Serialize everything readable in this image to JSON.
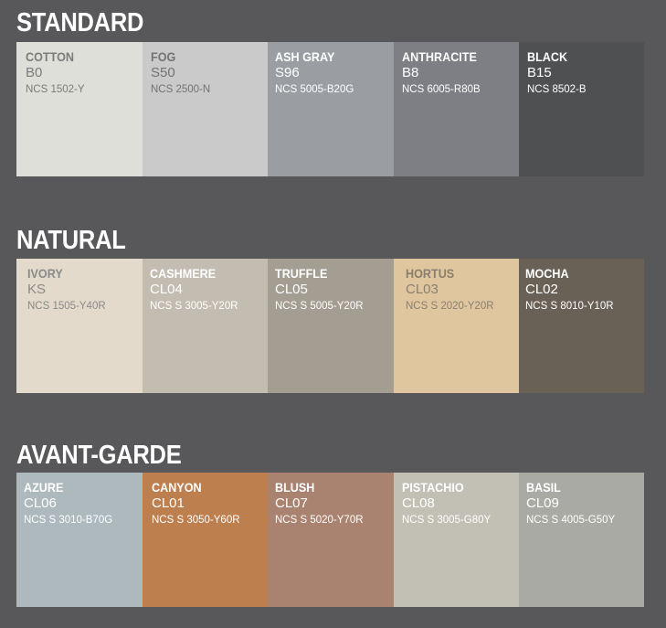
{
  "sections": [
    {
      "title": "STANDARD",
      "swatches": [
        {
          "name": "COTTON",
          "code": "B0",
          "ncs": "NCS 1502-Y",
          "color": "#dfdfd9",
          "name_color": "#7b7b7b",
          "text_color": "#7b7b7b"
        },
        {
          "name": "FOG",
          "code": "S50",
          "ncs": "NCS 2500-N",
          "color": "#cacaca",
          "name_color": "#737373",
          "text_color": "#737373"
        },
        {
          "name": "ASH GRAY",
          "code": "S96",
          "ncs": "NCS 5005-B20G",
          "color": "#9a9ea3",
          "name_color": "#ffffff",
          "text_color": "#ffffff"
        },
        {
          "name": "ANTHRACITE",
          "code": "B8",
          "ncs": "NCS 6005-R80B",
          "color": "#7d7f85",
          "name_color": "#ffffff",
          "text_color": "#ffffff"
        },
        {
          "name": "BLACK",
          "code": "B15",
          "ncs": "NCS 8502-B",
          "color": "#4f5052",
          "name_color": "#ffffff",
          "text_color": "#ffffff"
        }
      ]
    },
    {
      "title": "NATURAL",
      "swatches": [
        {
          "name": "IVORY",
          "code": "KS",
          "ncs": "NCS 1505-Y40R",
          "color": "#e3dacb",
          "name_color": "#8a8a8a",
          "text_color": "#8a8a8a"
        },
        {
          "name": "CASHMERE",
          "code": "CL04",
          "ncs": "NCS S 3005-Y20R",
          "color": "#c3bcb0",
          "name_color": "#ffffff",
          "text_color": "#ffffff"
        },
        {
          "name": "TRUFFLE",
          "code": "CL05",
          "ncs": "NCS S 5005-Y20R",
          "color": "#a39d92",
          "name_color": "#ffffff",
          "text_color": "#ffffff"
        },
        {
          "name": "HORTUS",
          "code": "CL03",
          "ncs": "NCS S 2020-Y20R",
          "color": "#dfc69f",
          "name_color": "#8a7f6e",
          "text_color": "#8a7f6e"
        },
        {
          "name": "MOCHA",
          "code": "CL02",
          "ncs": "NCS S 8010-Y10R",
          "color": "#696155",
          "name_color": "#ffffff",
          "text_color": "#ffffff"
        }
      ]
    },
    {
      "title": "AVANT-GARDE",
      "swatches": [
        {
          "name": "AZURE",
          "code": "CL06",
          "ncs": "NCS S 3010-B70G",
          "color": "#adb9bd",
          "name_color": "#ffffff",
          "text_color": "#ffffff"
        },
        {
          "name": "CANYON",
          "code": "CL01",
          "ncs": "NCS S 3050-Y60R",
          "color": "#be7f4f",
          "name_color": "#ffffff",
          "text_color": "#ffffff"
        },
        {
          "name": "BLUSH",
          "code": "CL07",
          "ncs": "NCS S 5020-Y70R",
          "color": "#a9836f",
          "name_color": "#ffffff",
          "text_color": "#ffffff"
        },
        {
          "name": "PISTACHIO",
          "code": "CL08",
          "ncs": "NCS S 3005-G80Y",
          "color": "#c2c0b5",
          "name_color": "#ffffff",
          "text_color": "#ffffff"
        },
        {
          "name": "BASIL",
          "code": "CL09",
          "ncs": "NCS S 4005-G50Y",
          "color": "#a9aaa4",
          "name_color": "#ffffff",
          "text_color": "#ffffff"
        }
      ]
    }
  ]
}
